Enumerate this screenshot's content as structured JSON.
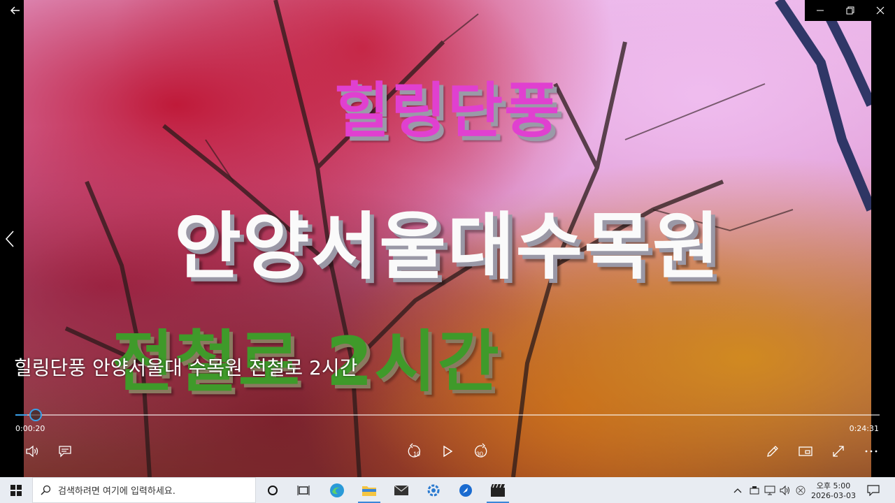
{
  "video": {
    "title_line1": "힐링단풍",
    "title_line2": "안양서울대수목원",
    "title_line3": "전철로 2시간",
    "caption": "힐링단풍 안양서울대 수목원 전철로 2시간"
  },
  "player": {
    "elapsed": "0:00:20",
    "duration": "0:24:31",
    "progress_fraction": 0.0137,
    "accent_color": "#3aa0e8",
    "icons": {
      "back": "back-arrow-icon",
      "minimize": "minimize-icon",
      "restore": "restore-icon",
      "close": "close-icon",
      "previous": "chevron-left-icon",
      "volume": "volume-icon",
      "subtitles": "subtitles-icon",
      "rewind": "rewind-10-icon",
      "play": "play-icon",
      "forward": "forward-30-icon",
      "edit": "pencil-icon",
      "miniview": "mini-view-icon",
      "fullscreen": "fullscreen-icon",
      "more": "more-icon"
    },
    "rewind_label": "10",
    "forward_label": "30"
  },
  "taskbar": {
    "search_placeholder": "검색하려면 여기에 입력하세요.",
    "time": "오후 5:00",
    "date": "2026-03-03",
    "apps": [
      "windows-start-icon",
      "cortana-icon",
      "task-view-icon",
      "edge-icon",
      "file-explorer-icon",
      "mail-icon",
      "settings-app-icon",
      "pin-app-icon",
      "movies-tv-icon"
    ]
  }
}
